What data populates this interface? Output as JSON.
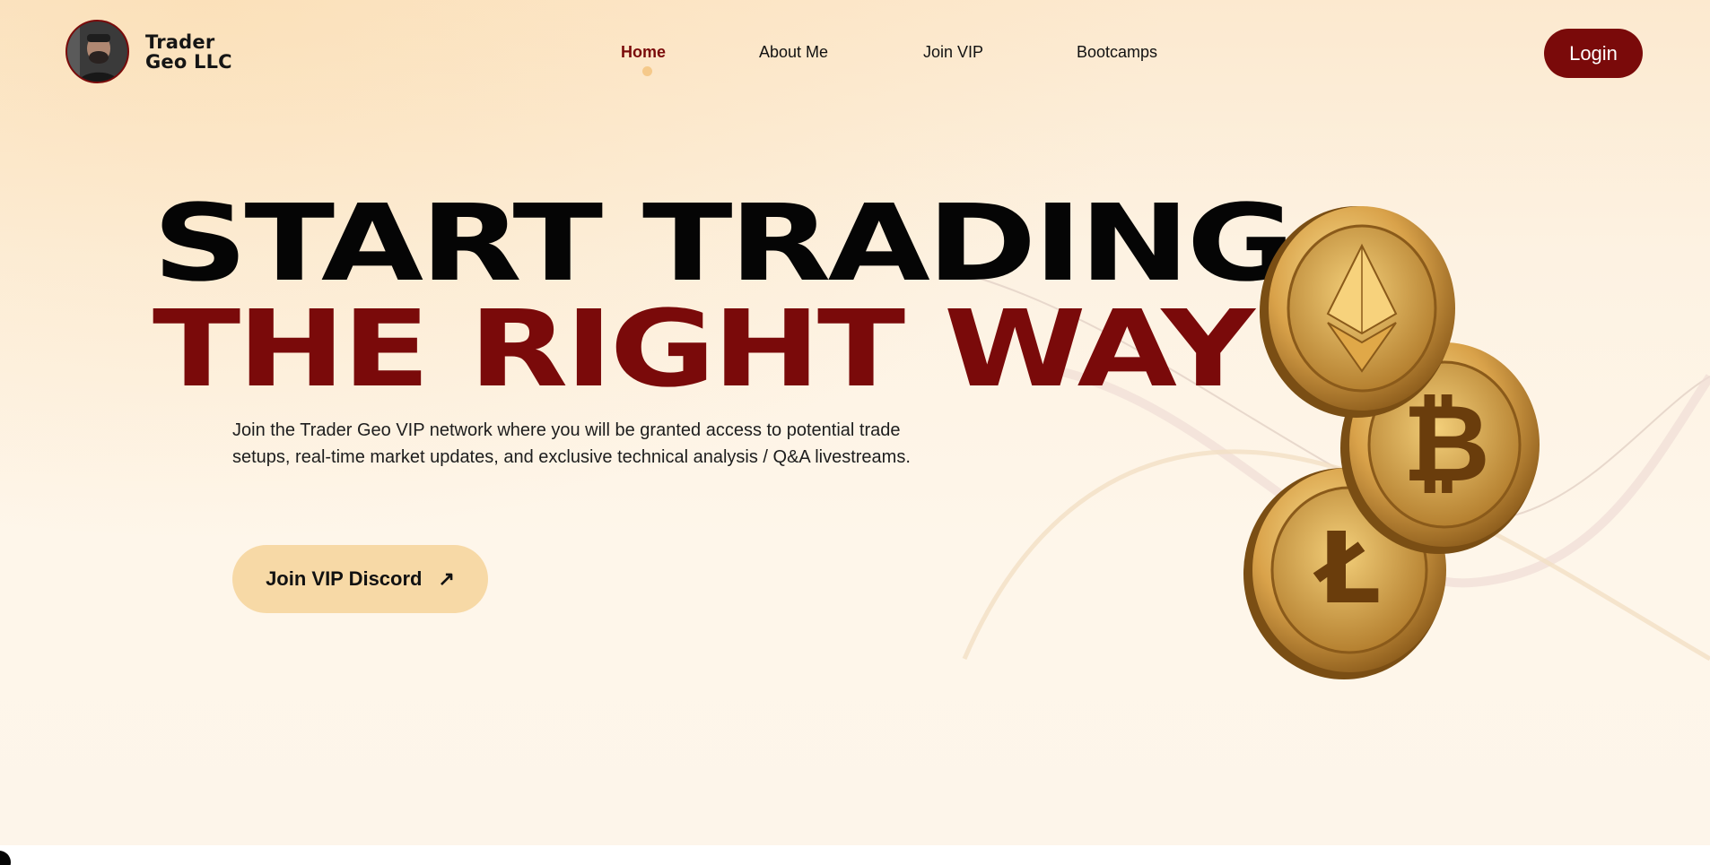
{
  "brand": {
    "name_line1": "Trader",
    "name_line2": "Geo LLC",
    "accent_color": "#7a0a0a"
  },
  "nav": {
    "items": [
      {
        "label": "Home",
        "active": true
      },
      {
        "label": "About Me",
        "active": false
      },
      {
        "label": "Join VIP",
        "active": false
      },
      {
        "label": "Bootcamps",
        "active": false
      }
    ],
    "login_label": "Login"
  },
  "hero": {
    "headline_line1": "START TRADING",
    "headline_line2": "THE RIGHT WAY",
    "description": "Join the Trader Geo VIP network where you will be granted access to potential trade setups, real-time market updates, and exclusive technical analysis / Q&A livestreams.",
    "cta_label": "Join VIP Discord",
    "cta_icon": "arrow-up-right-icon",
    "coins": [
      "ethereum-coin",
      "bitcoin-coin",
      "litecoin-coin"
    ]
  },
  "colors": {
    "primary": "#7a0a0a",
    "cta_background": "#f7d9a6",
    "nav_active_dot": "#f5c98a",
    "coin_gold": "#d9a24a"
  }
}
